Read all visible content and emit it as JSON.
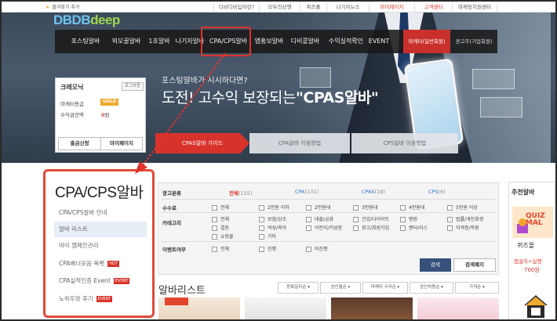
{
  "topbar": {
    "favorite": "즐겨찾기 추가",
    "links": [
      "디비디비딥이란?",
      "모두의상행",
      "퀴즈풀",
      "나기자뉴스",
      "마이페이지",
      "고객센터",
      "마케팅지원센터"
    ]
  },
  "logo": {
    "part1": "DBDB",
    "part2": "deep"
  },
  "nav": {
    "items": [
      "포스팅알바",
      "외모꿀알바",
      "1초알바",
      "나기자알바",
      "CPA/CPS알바",
      "앱홍보알바",
      "디비콜알바",
      "수익실적확인",
      "EVENT"
    ],
    "marketer": "마케터(일반회원)",
    "advertiser": "광고주(기업회원)"
  },
  "login": {
    "username": "크레오닉",
    "logout": "로그아웃",
    "grade_label": "마케터등급",
    "grade_value": "GOLD",
    "cash_label": "수익금잔액",
    "cash_value": "0",
    "cash_unit": "원",
    "withdraw": "출금신청",
    "mypage": "마이페이지"
  },
  "hero": {
    "subtitle": "포스팅알바가 시시하다면?",
    "title_prefix": "도전! 고수익 보장되는",
    "title_bold": "\"CPAS알바\"",
    "tabs": [
      "CPAS알바 가이드",
      "CPA알바 이용방법",
      "CPS알바 이용방법"
    ]
  },
  "sidebar": {
    "title": "CPA/CPS알바",
    "items": [
      {
        "label": "CPA/CPS알바 안내",
        "badge": ""
      },
      {
        "label": "알바 리스트",
        "badge": ""
      },
      {
        "label": "마이 캠페인관리",
        "badge": ""
      },
      {
        "label": "CPA배너모음 목록",
        "badge": "HOT"
      },
      {
        "label": "CPA실적인증 Event",
        "badge": "EVENT"
      },
      {
        "label": "노하우와 후기",
        "badge": "EVENT"
      }
    ]
  },
  "filter": {
    "labels": {
      "category": "광고분류",
      "fee": "수수료",
      "kategori": "카테고리",
      "event": "이벤트여부"
    },
    "categories": [
      {
        "name": "전체",
        "count": "(155)",
        "color": "#d8332b"
      },
      {
        "name": "CPA",
        "count": "(131)",
        "color": "#2a6fc9"
      },
      {
        "name": "CPAS",
        "count": "(18)",
        "color": "#2a6fc9"
      },
      {
        "name": "CPS",
        "count": "(6)",
        "color": "#2a6fc9"
      }
    ],
    "fees": [
      "전체",
      "2만원 이하",
      "2만원대",
      "3만원대",
      "4만원대",
      "5만원 이상"
    ],
    "cats_row1": [
      "전체",
      "보험/상조",
      "대출/금융",
      "건강/다이어트",
      "병원",
      "법률/개인회생"
    ],
    "cats_row2": [
      "결혼",
      "여성/육아",
      "어린이/키성장",
      "광고/회원가입",
      "렌터/리스",
      "자격증/학원"
    ],
    "cats_row3": [
      "쇼핑몰",
      "기타"
    ],
    "events": [
      "전체",
      "진행",
      "미진행"
    ],
    "search": "검색",
    "reset": "검색폐지"
  },
  "list": {
    "title": "알바리스트",
    "sorts": [
      "등록일자순",
      "승인율순",
      "마케터 수익순",
      "승인허용순",
      "가격순"
    ]
  },
  "recommend": {
    "title": "추천알바",
    "quiz_logo": "QUIZ MAL",
    "name": "퀴즈몰",
    "sub": "앱설치+실행",
    "amount": "700원"
  },
  "colors": {
    "accent_red": "#d8332b",
    "nav_bg": "#191919",
    "search_blue": "#37507c"
  }
}
